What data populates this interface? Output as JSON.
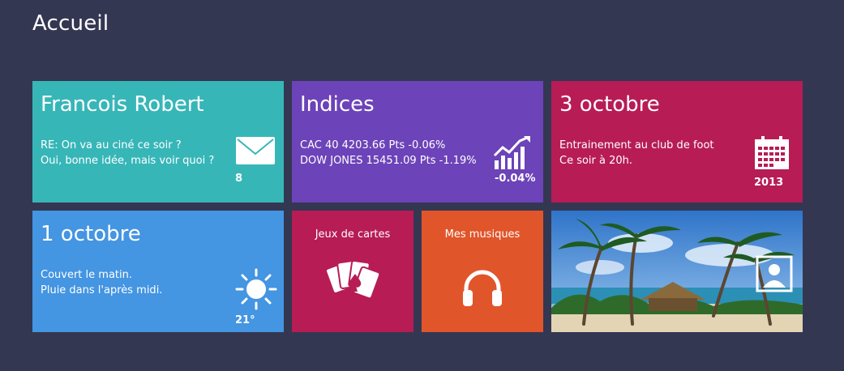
{
  "page": {
    "title": "Accueil"
  },
  "colors": {
    "background": "#343752",
    "mail_tile": "#37b6b8",
    "indices_tile": "#6c43b8",
    "calendar_tile": "#b71c55",
    "weather_tile": "#4495e2",
    "games_tile": "#b71c55",
    "music_tile": "#e1552b"
  },
  "tiles": {
    "mail": {
      "title": "Francois Robert",
      "line1": "RE: On va au ciné ce soir ?",
      "line2": "Oui, bonne idée, mais voir quoi ?",
      "count": "8",
      "icon": "envelope-icon"
    },
    "indices": {
      "title": "Indices",
      "line1": "CAC 40 4203.66 Pts -0.06%",
      "line2": "DOW JONES 15451.09 Pts -1.19%",
      "change": "-0.04%",
      "icon": "stock-chart-icon"
    },
    "calendar": {
      "title": "3 octobre",
      "line1": "Entrainement au club de foot",
      "line2": "Ce soir à 20h.",
      "year": "2013",
      "icon": "calendar-icon"
    },
    "weather": {
      "title": "1 octobre",
      "line1": "Couvert le matin.",
      "line2": "Pluie dans l'après midi.",
      "temperature": "21°",
      "icon": "sun-icon"
    },
    "games": {
      "label": "Jeux de cartes",
      "icon": "playing-cards-icon"
    },
    "music": {
      "label": "Mes musiques",
      "icon": "headphones-icon"
    },
    "photos": {
      "icon": "photo-person-icon"
    }
  }
}
